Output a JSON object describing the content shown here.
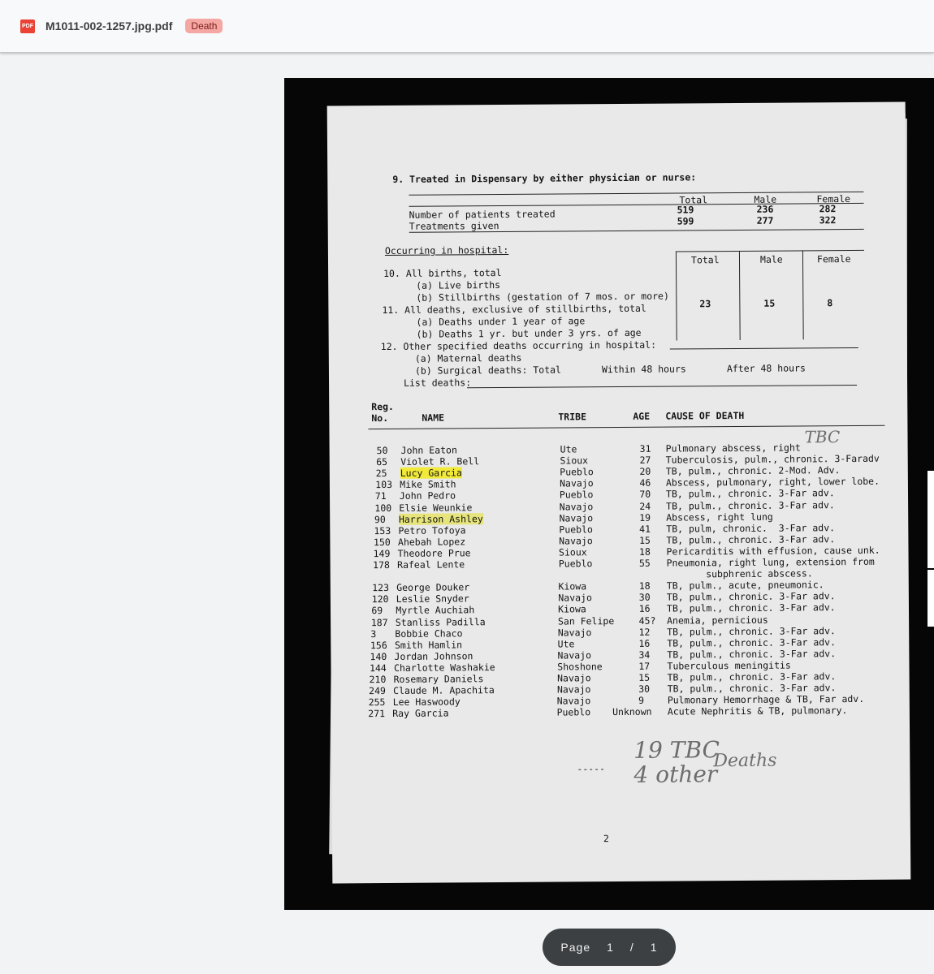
{
  "header": {
    "file_type_icon": "pdf-icon",
    "file_type_label": "PDF",
    "filename": "M1011-002-1257.jpg.pdf",
    "tag": "Death",
    "tag_color": "#f4a7a3"
  },
  "pager": {
    "label": "Page",
    "current": "1",
    "separator": "/",
    "total": "1"
  },
  "document": {
    "section9": "9. Treated in Dispensary by either physician or nurse:",
    "col_total": "Total",
    "col_male": "Male",
    "col_female": "Female",
    "patients_row": "Number of patients treated",
    "treatments_row": "Treatments given",
    "patients_vals": [
      "519",
      "236",
      "282"
    ],
    "treatments_vals": [
      "599",
      "277",
      "322"
    ],
    "occurring": "Occurring in hospital:",
    "s10": "10. All births, total",
    "s10a": "(a) Live births",
    "s10b": "(b) Stillbirths (gestation of 7 mos. or more)",
    "s11": "11. All deaths, exclusive of stillbirths, total",
    "s11_vals": [
      "23",
      "15",
      "8"
    ],
    "s11a": "(a) Deaths under 1 year of age",
    "s11b": "(b) Deaths 1 yr. but under 3 yrs. of age",
    "s12": "12. Other specified deaths occurring in hospital:",
    "s12a": "(a) Maternal deaths",
    "s12b": "(b) Surgical deaths: Total",
    "within48": "Within 48 hours",
    "after48": "After 48 hours",
    "list_deaths": "List deaths:",
    "col_reg": "Reg.",
    "col_no": "No.",
    "col_name": "NAME",
    "col_tribe": "TRIBE",
    "col_age": "AGE",
    "col_cause": "CAUSE OF DEATH",
    "rows": [
      {
        "no": "50",
        "name": "John Eaton",
        "tribe": "Ute",
        "age": "31",
        "cause": "Pulmonary abscess, right"
      },
      {
        "no": "65",
        "name": "Violet R. Bell",
        "tribe": "Sioux",
        "age": "27",
        "cause": "Tuberculosis, pulm., chronic. 3-Faradv"
      },
      {
        "no": "25",
        "name": "Lucy Garcia",
        "tribe": "Pueblo",
        "age": "20",
        "cause": "TB, pulm., chronic. 2-Mod. Adv."
      },
      {
        "no": "103",
        "name": "Mike Smith",
        "tribe": "Navajo",
        "age": "46",
        "cause": "Abscess, pulmonary, right, lower lobe."
      },
      {
        "no": "71",
        "name": "John Pedro",
        "tribe": "Pueblo",
        "age": "70",
        "cause": "TB, pulm., chronic. 3-Far adv."
      },
      {
        "no": "100",
        "name": "Elsie Weunkie",
        "tribe": "Navajo",
        "age": "24",
        "cause": "TB, pulm., chronic. 3-Far adv."
      },
      {
        "no": "90",
        "name": "Harrison Ashley",
        "tribe": "Navajo",
        "age": "19",
        "cause": "Abscess, right lung"
      },
      {
        "no": "153",
        "name": "Petro Tofoya",
        "tribe": "Pueblo",
        "age": "41",
        "cause": "TB, pulm, chronic.  3-Far adv."
      },
      {
        "no": "150",
        "name": "Ahebah Lopez",
        "tribe": "Navajo",
        "age": "15",
        "cause": "TB, pulm., chronic. 3-Far adv."
      },
      {
        "no": "149",
        "name": "Theodore Prue",
        "tribe": "Sioux",
        "age": "18",
        "cause": "Pericarditis with effusion, cause unk."
      },
      {
        "no": "178",
        "name": "Rafeal Lente",
        "tribe": "Pueblo",
        "age": "55",
        "cause": "Pneumonia, right lung, extension from"
      },
      {
        "no": "",
        "name": "",
        "tribe": "",
        "age": "",
        "cause": "       subphrenic abscess."
      },
      {
        "no": "123",
        "name": "George Douker",
        "tribe": "Kiowa",
        "age": "18",
        "cause": "TB, pulm., acute, pneumonic."
      },
      {
        "no": "120",
        "name": "Leslie Snyder",
        "tribe": "Navajo",
        "age": "30",
        "cause": "TB, pulm., chronic. 3-Far adv."
      },
      {
        "no": "69",
        "name": "Myrtle Auchiah",
        "tribe": "Kiowa",
        "age": "16",
        "cause": "TB, pulm., chronic. 3-Far adv."
      },
      {
        "no": "187",
        "name": "Stanliss Padilla",
        "tribe": "San Felipe",
        "age": "45?",
        "cause": "Anemia, pernicious"
      },
      {
        "no": "3",
        "name": "Bobbie Chaco",
        "tribe": "Navajo",
        "age": "12",
        "cause": "TB, pulm., chronic. 3-Far adv."
      },
      {
        "no": "156",
        "name": "Smith Hamlin",
        "tribe": "Ute",
        "age": "16",
        "cause": "TB, pulm., chronic. 3-Far adv."
      },
      {
        "no": "140",
        "name": "Jordan Johnson",
        "tribe": "Navajo",
        "age": "34",
        "cause": "TB, pulm., chronic. 3-Far adv."
      },
      {
        "no": "144",
        "name": "Charlotte Washakie",
        "tribe": "Shoshone",
        "age": "17",
        "cause": "Tuberculous meningitis"
      },
      {
        "no": "210",
        "name": "Rosemary Daniels",
        "tribe": "Navajo",
        "age": "15",
        "cause": "TB, pulm., chronic. 3-Far adv."
      },
      {
        "no": "249",
        "name": "Claude M. Apachita",
        "tribe": "Navajo",
        "age": "30",
        "cause": "TB, pulm., chronic. 3-Far adv."
      },
      {
        "no": "255",
        "name": "Lee Haswoody",
        "tribe": "Navajo",
        "age": "9",
        "cause": "Pulmonary Hemorrhage & TB, Far adv."
      },
      {
        "no": "271",
        "name": "Ray Garcia",
        "tribe": "Pueblo",
        "age": "Unknown",
        "cause": "Acute Nephritis & TB, pulmonary."
      }
    ],
    "hand_tbc": "TBC",
    "hand_tally1": "19 TBC",
    "hand_tally2": "4 other",
    "hand_deaths": "Deaths",
    "dashes": "-----",
    "page_number": "2"
  }
}
